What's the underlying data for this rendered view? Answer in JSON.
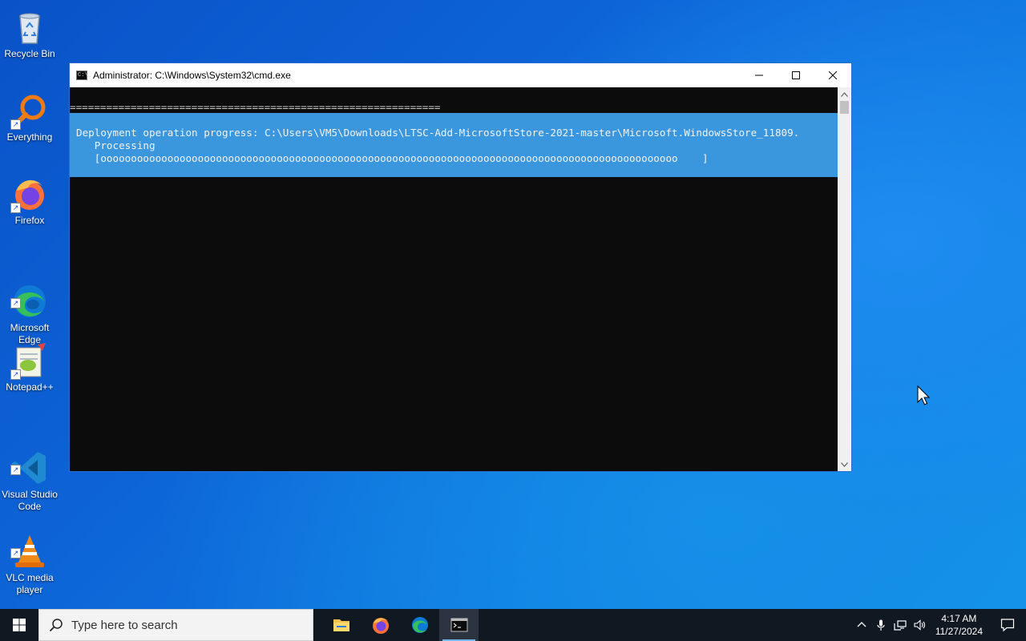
{
  "desktop": {
    "icons": [
      {
        "label": "Recycle Bin",
        "icon": "recycle-bin-icon"
      },
      {
        "label": "Everything",
        "icon": "everything-search-icon"
      },
      {
        "label": "Firefox",
        "icon": "firefox-icon"
      },
      {
        "label": "Microsoft\nEdge",
        "icon": "edge-icon"
      },
      {
        "label": "Notepad++",
        "icon": "notepadplusplus-icon"
      },
      {
        "label": "Visual Studio\nCode",
        "icon": "vscode-icon"
      },
      {
        "label": "VLC media\nplayer",
        "icon": "vlc-icon"
      }
    ]
  },
  "window": {
    "title": "Administrator: C:\\Windows\\System32\\cmd.exe",
    "icon_text": "C:\\_"
  },
  "console": {
    "separator": "=============================================================",
    "progress_line": "Deployment operation progress: C:\\Users\\VM5\\Downloads\\LTSC-Add-MicrosoftStore-2021-master\\Microsoft.WindowsStore_11809.",
    "status_line": "   Processing",
    "bar_line": "   [ooooooooooooooooooooooooooooooooooooooooooooooooooooooooooooooooooooooooooooooooooooooooooooooo    ]",
    "highlight_color": "#3a96dd"
  },
  "taskbar": {
    "search_placeholder": "Type here to search",
    "apps": [
      "file-explorer-icon",
      "firefox-icon",
      "edge-icon",
      "cmd-icon"
    ],
    "time": "4:17 AM",
    "date": "11/27/2024"
  }
}
